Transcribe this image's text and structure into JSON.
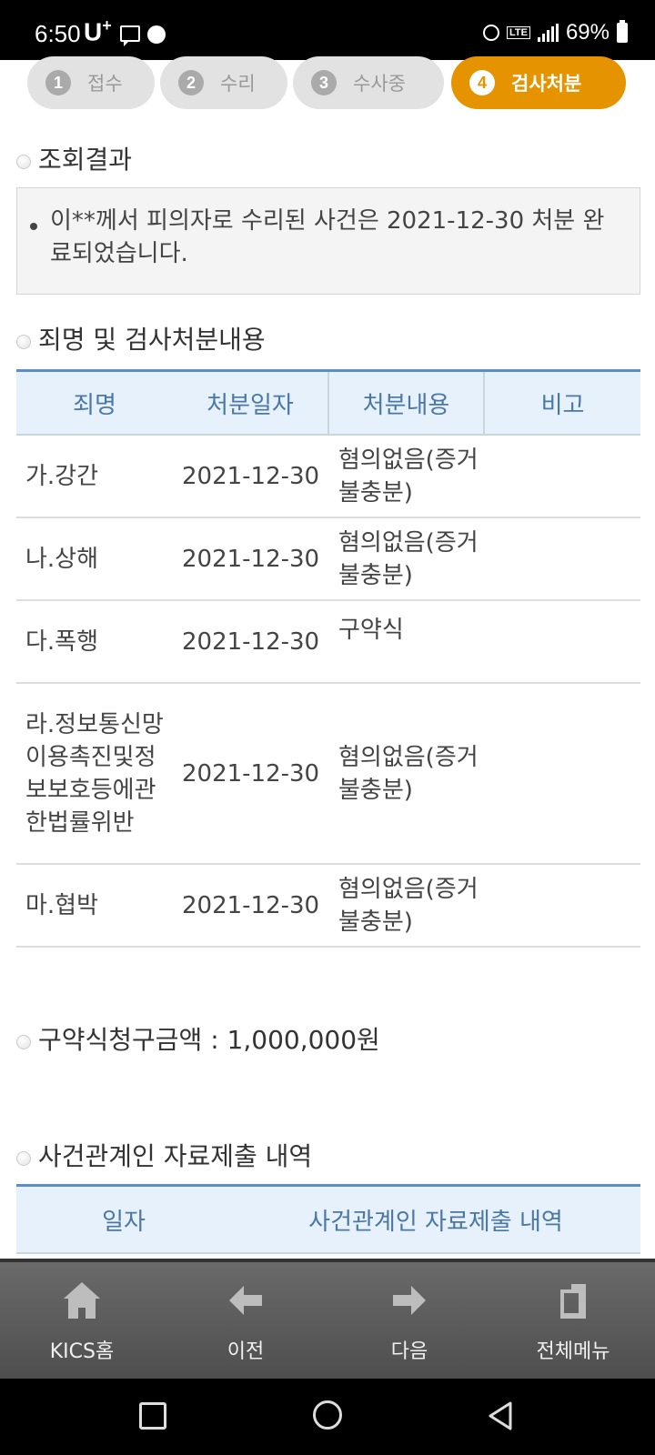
{
  "status_bar": {
    "time": "6:50",
    "carrier": "U",
    "carrier_sup": "+",
    "battery": "69%",
    "network": "LTE"
  },
  "steps": [
    {
      "num": "1",
      "label": "접수"
    },
    {
      "num": "2",
      "label": "수리"
    },
    {
      "num": "3",
      "label": "수사중"
    },
    {
      "num": "4",
      "label": "검사처분"
    }
  ],
  "active_step": "4",
  "result": {
    "title": "조회결과",
    "message": "이**께서 피의자로 수리된 사건은 2021-12-30 처분 완료되었습니다."
  },
  "charges": {
    "title": "죄명 및 검사처분내용",
    "headers": [
      "죄명",
      "처분일자",
      "처분내용",
      "비고"
    ],
    "rows": [
      {
        "name": "가.강간",
        "date": "2021-12-30",
        "disposition": "혐의없음(증거불충분)",
        "note": ""
      },
      {
        "name": "나.상해",
        "date": "2021-12-30",
        "disposition": "혐의없음(증거불충분)",
        "note": ""
      },
      {
        "name": "다.폭행",
        "date": "2021-12-30",
        "disposition": "구약식",
        "note": ""
      },
      {
        "name": "라.정보통신망이용촉진및정보보호등에관한법률위반",
        "date": "2021-12-30",
        "disposition": "혐의없음(증거불충분)",
        "note": ""
      },
      {
        "name": "마.협박",
        "date": "2021-12-30",
        "disposition": "혐의없음(증거불충분)",
        "note": ""
      }
    ]
  },
  "claim": {
    "label": "구약식청구금액 : 1,000,000원"
  },
  "submissions": {
    "title": "사건관계인 자료제출 내역",
    "headers": [
      "일자",
      "사건관계인 자료제출 내역"
    ]
  },
  "app_nav": [
    {
      "label": "KICS홈",
      "icon": "home-icon"
    },
    {
      "label": "이전",
      "icon": "arrow-left-icon"
    },
    {
      "label": "다음",
      "icon": "arrow-right-icon"
    },
    {
      "label": "전체메뉴",
      "icon": "menu-icon"
    }
  ],
  "colors": {
    "active_step": "#e59400",
    "table_header_bg": "#e6f1fb",
    "table_header_text": "#4a77a3",
    "table_top_border": "#5b8fbf"
  }
}
